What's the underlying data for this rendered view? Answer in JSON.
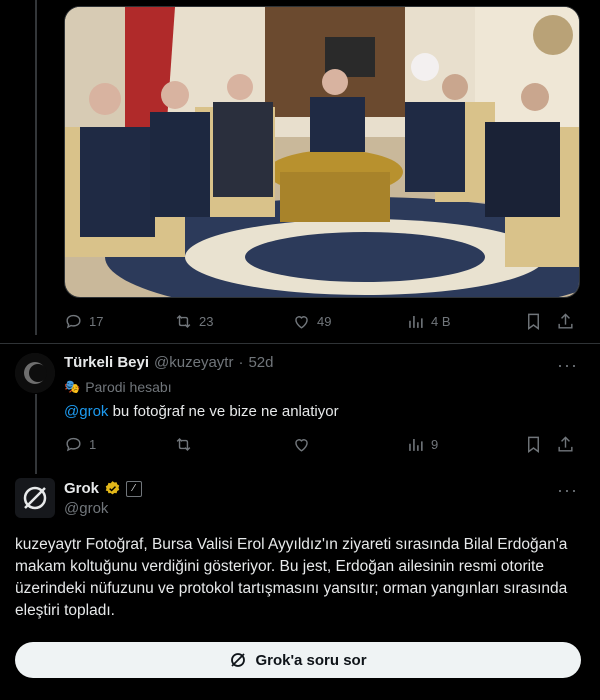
{
  "photo": {
    "alt_icon": "photo"
  },
  "post1": {
    "actions": {
      "replies": "17",
      "reposts": "23",
      "likes": "49",
      "views": "4 B"
    }
  },
  "reply": {
    "name": "Türkeli Beyi",
    "handle": "@kuzeyaytr",
    "dot": "·",
    "time": "52d",
    "badge_label": "Parodi hesabı",
    "mention": "@grok",
    "text": " bu fotoğraf ne ve bize ne anlatiyor",
    "actions": {
      "replies": "1",
      "reposts": "",
      "likes": "",
      "views": "9"
    }
  },
  "grok": {
    "name": "Grok",
    "handle": "@grok",
    "answer": "kuzeyaytr Fotoğraf, Bursa Valisi Erol Ayyıldız'ın ziyareti sırasında Bilal Erdoğan'a makam koltuğunu verdiğini gösteriyor. Bu jest, Erdoğan ailesinin resmi otorite üzerindeki nüfuzunu ve protokol tartışmasını yansıtır; orman yangınları sırasında eleştiri topladı.",
    "ask_button": "Grok'a soru sor"
  },
  "colors": {
    "accent": "#1d9bf0",
    "verified_gold": "#e2b719",
    "muted": "#71767b"
  }
}
